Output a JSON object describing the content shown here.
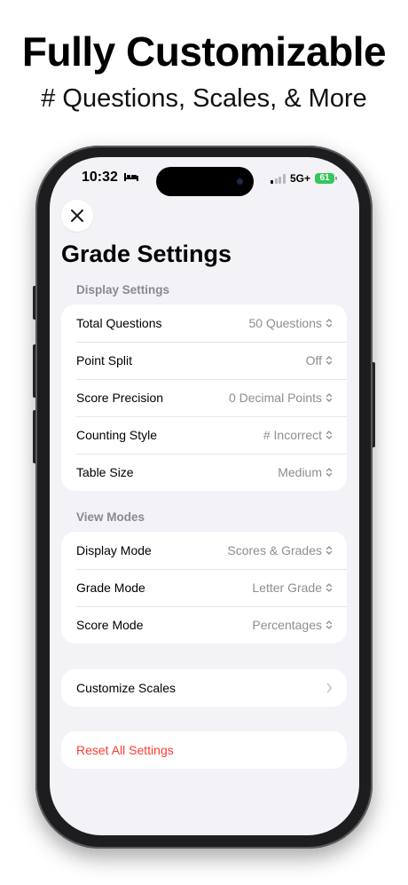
{
  "headline": "Fully Customizable",
  "subheadline": "# Questions, Scales, & More",
  "status": {
    "time": "10:32",
    "network": "5G+",
    "battery": "61"
  },
  "page_title": "Grade Settings",
  "display_settings": {
    "header": "Display Settings",
    "rows": [
      {
        "label": "Total Questions",
        "value": "50 Questions"
      },
      {
        "label": "Point Split",
        "value": "Off"
      },
      {
        "label": "Score Precision",
        "value": "0 Decimal Points"
      },
      {
        "label": "Counting Style",
        "value": "# Incorrect"
      },
      {
        "label": "Table Size",
        "value": "Medium"
      }
    ]
  },
  "view_modes": {
    "header": "View Modes",
    "rows": [
      {
        "label": "Display Mode",
        "value": "Scores & Grades"
      },
      {
        "label": "Grade Mode",
        "value": "Letter Grade"
      },
      {
        "label": "Score Mode",
        "value": "Percentages"
      }
    ]
  },
  "customize_scales": {
    "label": "Customize Scales"
  },
  "reset": {
    "label": "Reset All Settings",
    "color": "#ff3b30"
  },
  "icons": {
    "close": "close-icon",
    "updown": "chevron-up-down-icon",
    "disclosure": "chevron-right-icon"
  }
}
